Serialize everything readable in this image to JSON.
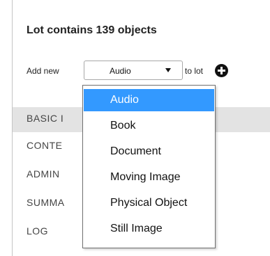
{
  "lot": {
    "title": "Lot contains 139 objects"
  },
  "add_row": {
    "label": "Add new",
    "selected": "Audio",
    "suffix": "to lot"
  },
  "sections": [
    "BASIC I",
    "CONTE",
    "ADMIN",
    "SUMMA",
    "LOG"
  ],
  "dropdown": {
    "options": [
      "Audio",
      "Book",
      "Document",
      "Moving Image",
      "Physical Object",
      "Still Image"
    ],
    "selected_index": 0
  },
  "colors": {
    "highlight": "#3399ff",
    "section_band": "#e3e3e3"
  }
}
